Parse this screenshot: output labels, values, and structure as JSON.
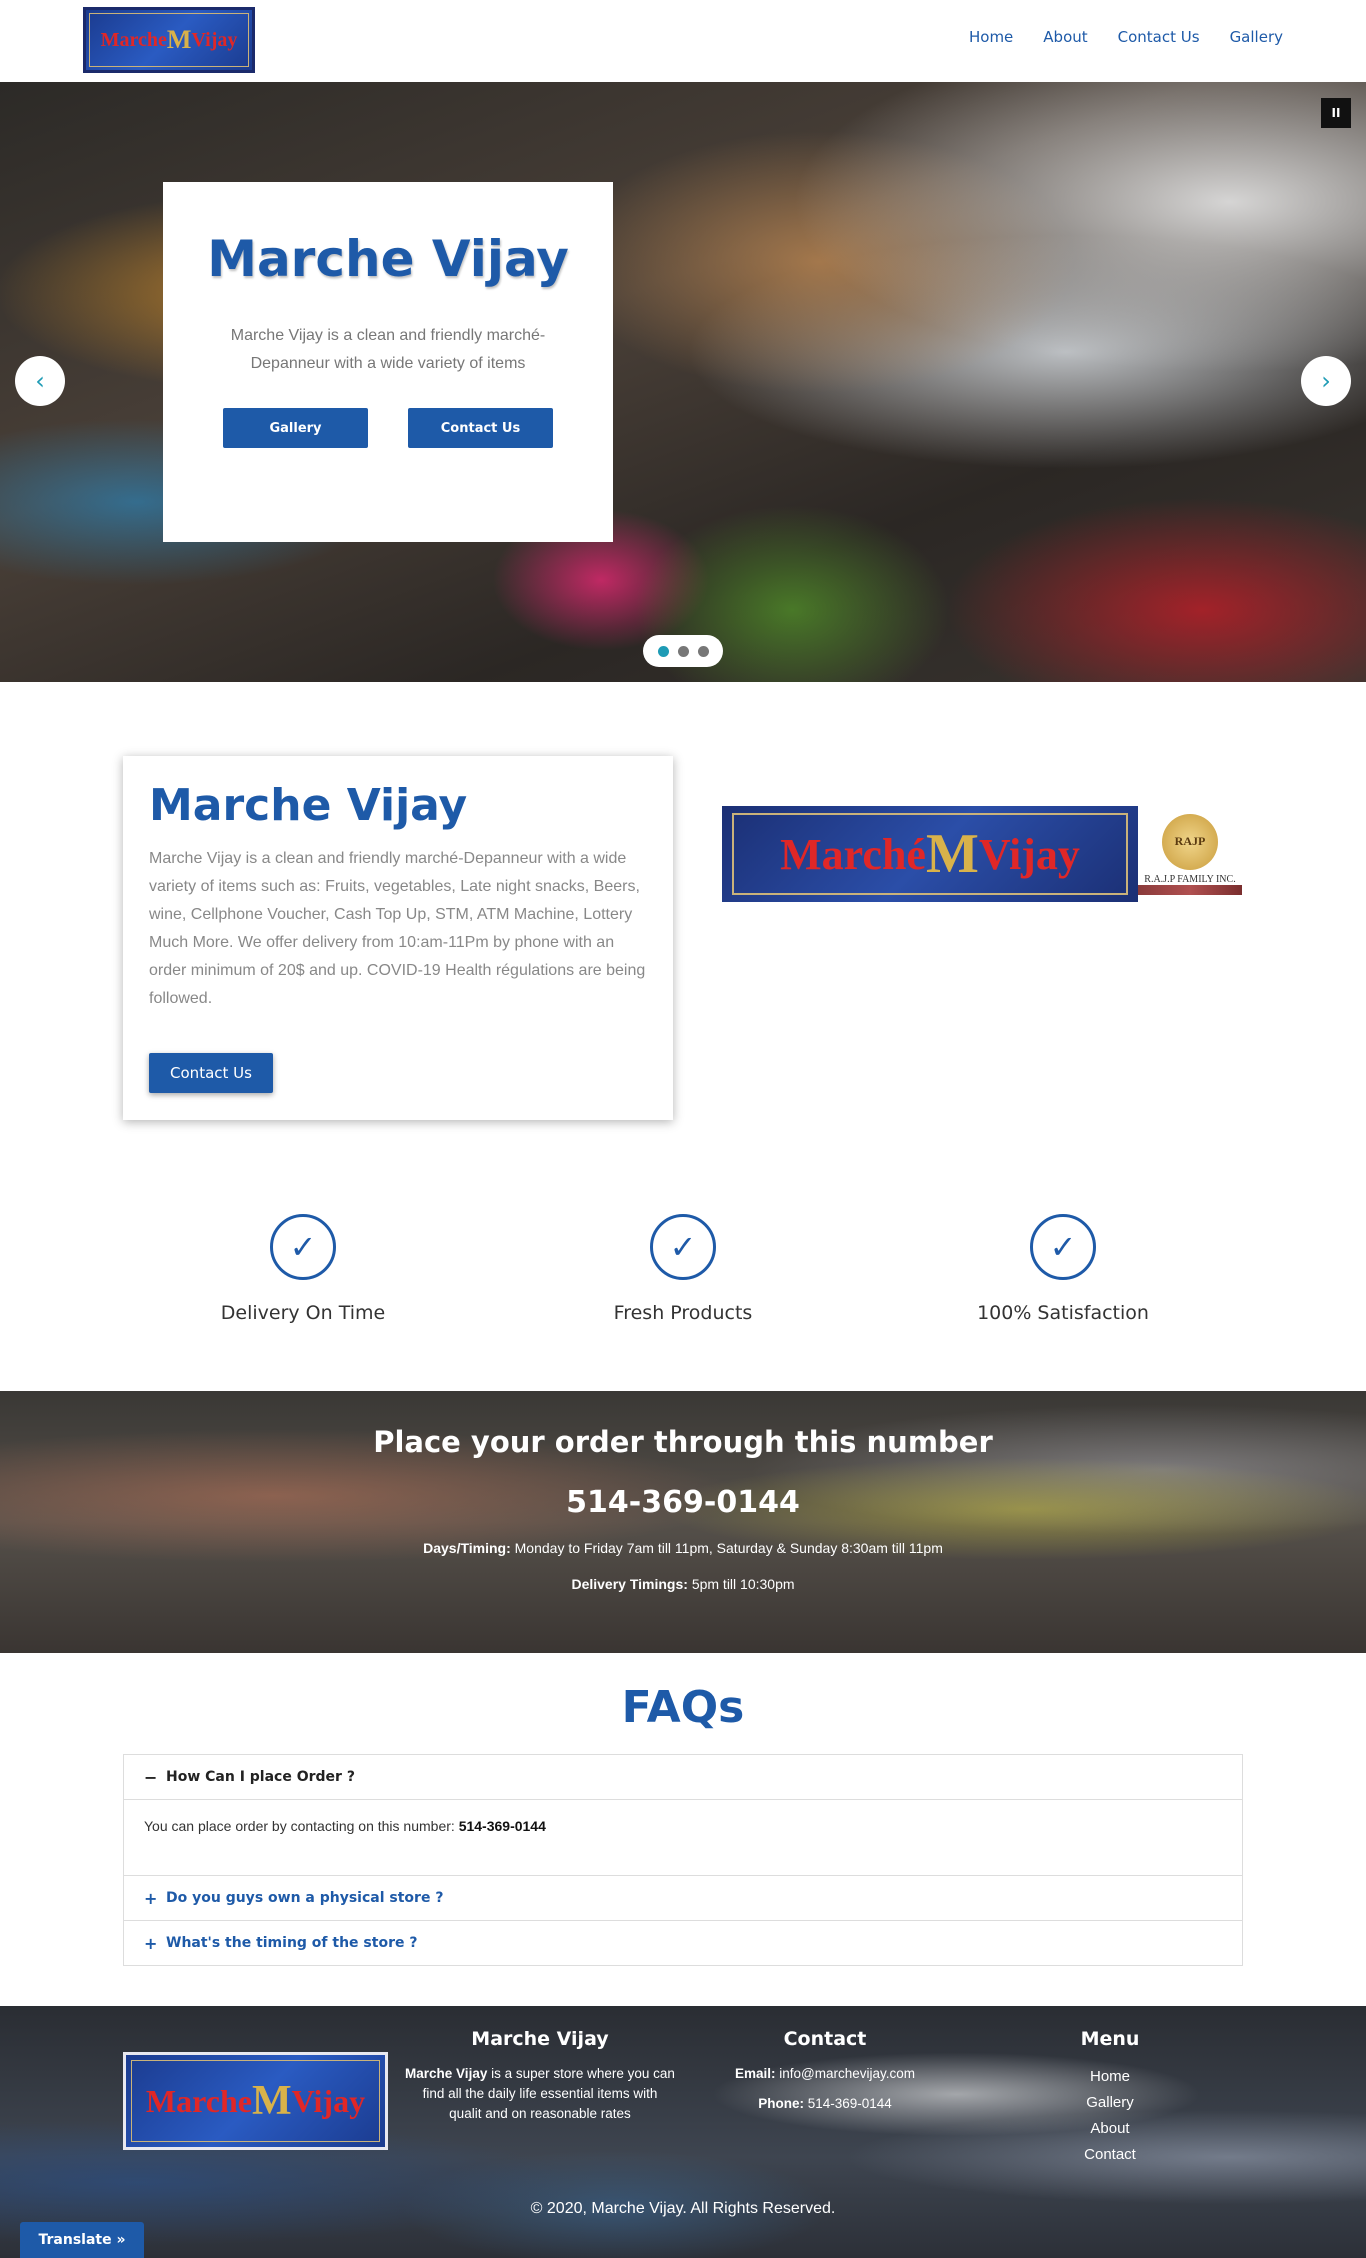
{
  "header": {
    "logo": {
      "text_left": "Marche",
      "text_m": "M",
      "text_right": "Vijay"
    },
    "nav": [
      "Home",
      "About",
      "Contact Us",
      "Gallery"
    ]
  },
  "hero": {
    "title": "Marche Vijay",
    "text": "Marche Vijay is a clean and friendly marché-Depanneur with a wide variety of items",
    "buttons": [
      "Gallery",
      "Contact Us"
    ],
    "prev_icon": "chevron-left-icon",
    "next_icon": "chevron-right-icon",
    "pause_icon": "pause-icon",
    "slides": 3,
    "active_slide": 1
  },
  "about": {
    "title": "Marche Vijay",
    "text": "Marche Vijay is a clean and friendly marché-Depanneur with a wide variety of items such as: Fruits, vegetables, Late night snacks, Beers, wine, Cellphone Voucher, Cash Top Up, STM, ATM Machine, Lottery Much More. We offer delivery from 10:am-11Pm by phone with an order minimum of 20$ and up. COVID-19 Health régulations are being followed.",
    "button": "Contact Us",
    "banner": {
      "text_left": "Marché",
      "text_m": "M",
      "text_right": "Vijay",
      "seal": "RAJP",
      "company": "R.A.J.P FAMILY INC."
    }
  },
  "features": [
    {
      "label": "Delivery On Time",
      "icon": "check-circle-icon"
    },
    {
      "label": "Fresh Products",
      "icon": "check-circle-icon"
    },
    {
      "label": "100% Satisfaction",
      "icon": "check-circle-icon"
    }
  ],
  "order": {
    "title": "Place your order through this number",
    "phone": "514-369-0144",
    "timing_label": "Days/Timing:",
    "timing_value": "Monday to Friday 7am till 11pm, Saturday & Sunday 8:30am till 11pm",
    "delivery_label": "Delivery Timings:",
    "delivery_value": "5pm till 10:30pm"
  },
  "faqs": {
    "title": "FAQs",
    "items": [
      {
        "q": "How Can I place Order ?",
        "open": true,
        "sign": "−",
        "a_text": "You can place order by contacting on this number: ",
        "a_bold": "514-369-0144"
      },
      {
        "q": "Do you guys own a physical store ?",
        "open": false,
        "sign": "+"
      },
      {
        "q": "What's the timing of the store ?",
        "open": false,
        "sign": "+"
      }
    ]
  },
  "footer": {
    "about_title": "Marche Vijay",
    "about_bold": "Marche Vijay",
    "about_text": " is a super store where you can find all the daily life essential items with qualit and on reasonable rates",
    "contact_title": "Contact",
    "email_label": "Email:",
    "email_value": "info@marchevijay.com",
    "phone_label": "Phone:",
    "phone_value": "514-369-0144",
    "menu_title": "Menu",
    "menu": [
      "Home",
      "Gallery",
      "About",
      "Contact"
    ],
    "copyright": "© 2020, Marche Vijay. All Rights Reserved."
  },
  "translate": "Translate »",
  "colors": {
    "brand_blue": "#1e5aa8",
    "accent_teal": "#1e9bb5"
  }
}
